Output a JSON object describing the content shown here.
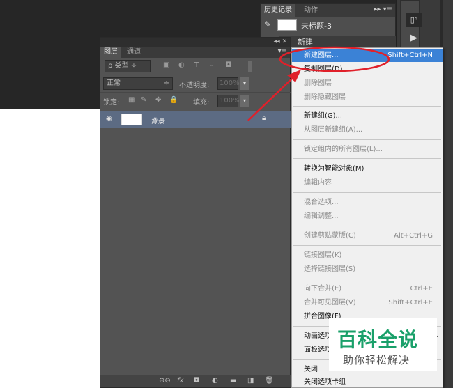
{
  "history_panel": {
    "tabs": [
      "历史记录",
      "动作"
    ],
    "menu_icon": "▸▸ ▾≡",
    "document_name": "未标题-3",
    "brush_icon": "brush-icon",
    "new_item": "新建"
  },
  "right_dock": {
    "btn1": "▯⁵",
    "btn2": "▶"
  },
  "layers_panel": {
    "title_controls": "◂◂ ✕",
    "tabs": [
      "图层",
      "通道"
    ],
    "tab_menu": "▾≡",
    "filter_kind": "ρ 类型",
    "filter_icons": [
      "▣",
      "◐",
      "T",
      "⌑",
      "◘"
    ],
    "blend_mode": "正常",
    "opacity_label": "不透明度:",
    "opacity_value": "100%",
    "lock_label": "锁定:",
    "lock_icons": [
      "▦",
      "✎",
      "✥",
      "🔒"
    ],
    "fill_label": "填充:",
    "fill_value": "100%",
    "layer_name": "背景",
    "bottom_icons": [
      "⊖⊖",
      "fx",
      "◘",
      "◐",
      "▬",
      "◨",
      "🗑"
    ]
  },
  "context_menu": {
    "items": [
      {
        "label": "新建图层...",
        "shortcut": "Shift+Ctrl+N",
        "state": "highlight"
      },
      {
        "label": "复制图层(D)...",
        "shortcut": "",
        "state": "enabled"
      },
      {
        "label": "删除图层",
        "shortcut": "",
        "state": "disabled"
      },
      {
        "label": "删除隐藏图层",
        "shortcut": "",
        "state": "disabled"
      },
      {
        "label": "新建组(G)...",
        "shortcut": "",
        "state": "enabled"
      },
      {
        "label": "从图层新建组(A)...",
        "shortcut": "",
        "state": "disabled"
      },
      {
        "label": "锁定组内的所有图层(L)...",
        "shortcut": "",
        "state": "disabled"
      },
      {
        "label": "转换为智能对象(M)",
        "shortcut": "",
        "state": "enabled"
      },
      {
        "label": "编辑内容",
        "shortcut": "",
        "state": "disabled"
      },
      {
        "label": "混合选项...",
        "shortcut": "",
        "state": "disabled"
      },
      {
        "label": "编辑调整...",
        "shortcut": "",
        "state": "disabled"
      },
      {
        "label": "创建剪贴蒙版(C)",
        "shortcut": "Alt+Ctrl+G",
        "state": "disabled"
      },
      {
        "label": "链接图层(K)",
        "shortcut": "",
        "state": "disabled"
      },
      {
        "label": "选择链接图层(S)",
        "shortcut": "",
        "state": "disabled"
      },
      {
        "label": "向下合并(E)",
        "shortcut": "Ctrl+E",
        "state": "disabled"
      },
      {
        "label": "合并可见图层(V)",
        "shortcut": "Shift+Ctrl+E",
        "state": "disabled"
      },
      {
        "label": "拼合图像(F)",
        "shortcut": "",
        "state": "disabled"
      },
      {
        "label": "动画选项",
        "shortcut": "",
        "state": "enabled"
      },
      {
        "label": "面板选项...",
        "shortcut": "",
        "state": "enabled"
      },
      {
        "label": "关闭",
        "shortcut": "",
        "state": "enabled"
      },
      {
        "label": "关闭选项卡组",
        "shortcut": "",
        "state": "enabled"
      }
    ]
  },
  "watermark": {
    "title": "百科全说",
    "subtitle": "助你轻松解决"
  },
  "colors": {
    "highlight": "#3b82d6",
    "annotation": "#e0202a",
    "watermark_green": "#1aa06a"
  }
}
